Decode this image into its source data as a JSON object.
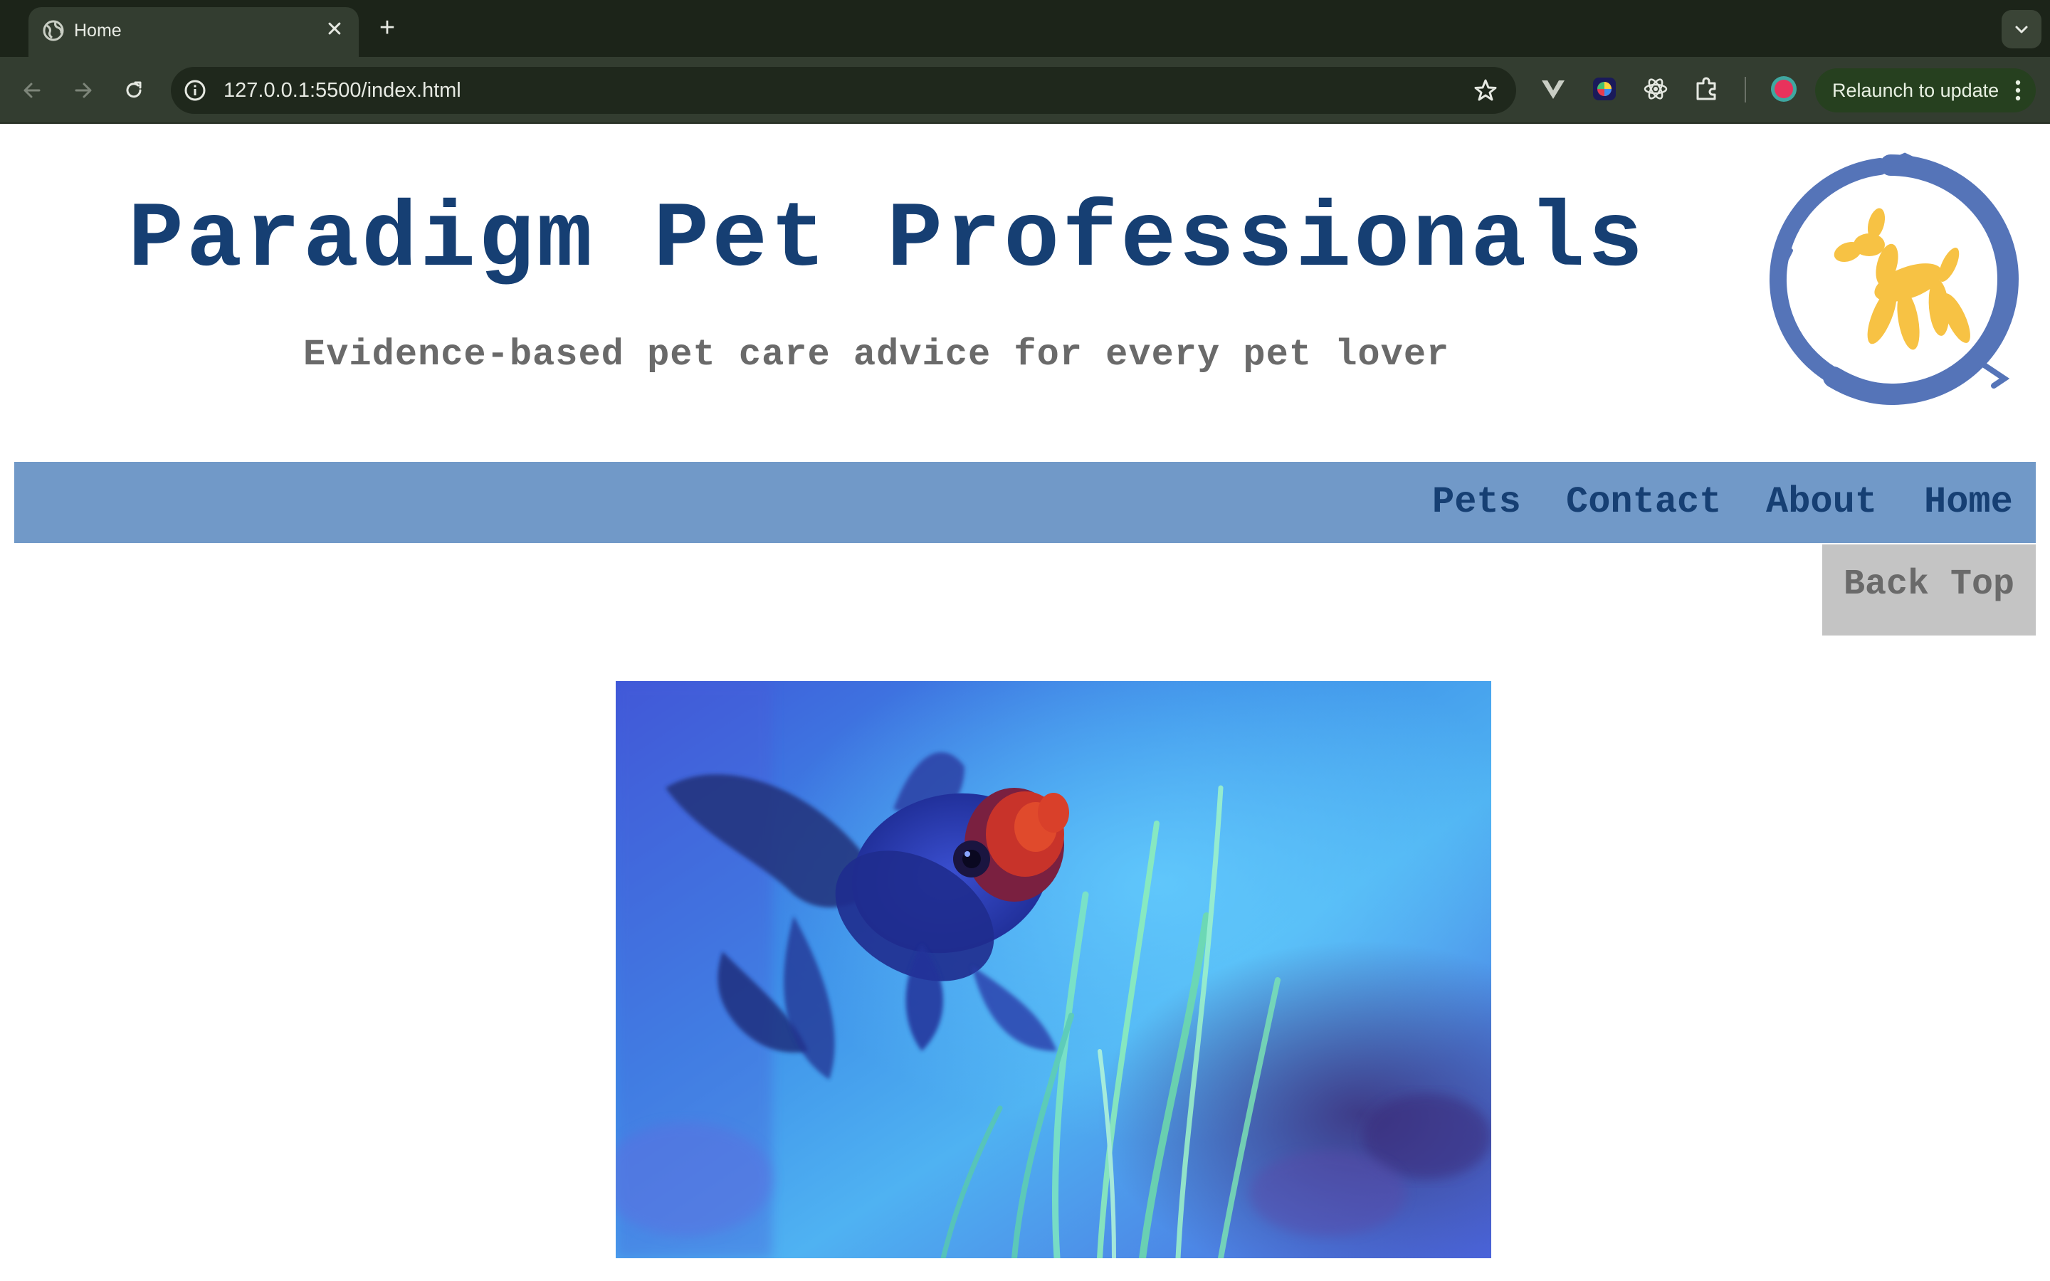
{
  "browser": {
    "tab_title": "Home",
    "url": "127.0.0.1:5500/index.html",
    "relaunch_label": "Relaunch to update"
  },
  "header": {
    "title": "Paradigm Pet Professionals",
    "tagline": "Evidence-based pet care advice for every pet lover",
    "logo_colors": {
      "ring": "#5574b8",
      "dog": "#f7c244"
    }
  },
  "nav": {
    "items": [
      {
        "label": "Pets"
      },
      {
        "label": "Contact"
      },
      {
        "label": "About"
      },
      {
        "label": "Home"
      }
    ],
    "back_top_label": "Back Top"
  },
  "colors": {
    "title": "#163f73",
    "nav_bar": "#7199c8",
    "tagline": "#6a6a6a",
    "back_top_bg": "#c4c4c4"
  },
  "hero": {
    "icon": "goldfish-photo"
  }
}
